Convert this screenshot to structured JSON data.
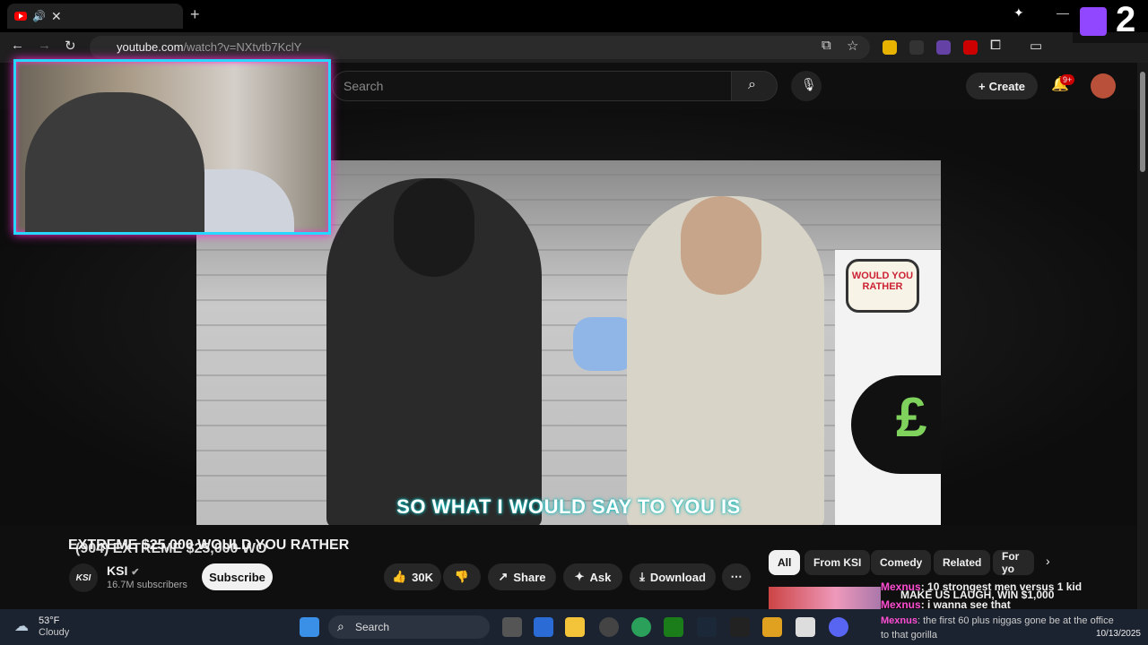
{
  "browser": {
    "tab_title": "(904) EXTREME $25,000 WO",
    "url_host": "youtube.com",
    "url_path": "/watch?v=NXtvtb7KclY"
  },
  "youtube": {
    "search_placeholder": "Search",
    "create_label": "Create",
    "notif_badge": "9+"
  },
  "video": {
    "caption": "SO WHAT I WOULD SAY TO YOU IS",
    "title": "EXTREME $25,000 WOULD YOU RATHER",
    "banner_logo": "WOULD YOU RATHER",
    "banner_symbol": "£"
  },
  "channel": {
    "avatar_text": "KSI",
    "name": "KSI",
    "subscribers": "16.7M subscribers",
    "subscribe_label": "Subscribe"
  },
  "actions": {
    "likes": "30K",
    "share": "Share",
    "ask": "Ask",
    "download": "Download"
  },
  "chips": [
    "All",
    "From KSI",
    "Comedy",
    "Related",
    "For yo"
  ],
  "overlay": {
    "twitch_count": "2",
    "chat": [
      {
        "user": "Mexnus",
        "msg": ": 10 strongest men versus 1 kid"
      },
      {
        "user": "",
        "msg": "MAKE US LAUGH, WIN $1,000"
      },
      {
        "user": "Mexnus",
        "msg": ": i wanna see that"
      },
      {
        "user": "Mexnus",
        "msg": ": the first 60 plus niggas gone be at the office"
      },
      {
        "user": "",
        "msg": "to that gorilla"
      }
    ]
  },
  "taskbar": {
    "temp": "53°F",
    "condition": "Cloudy",
    "search": "Search",
    "date": "10/13/2025"
  }
}
